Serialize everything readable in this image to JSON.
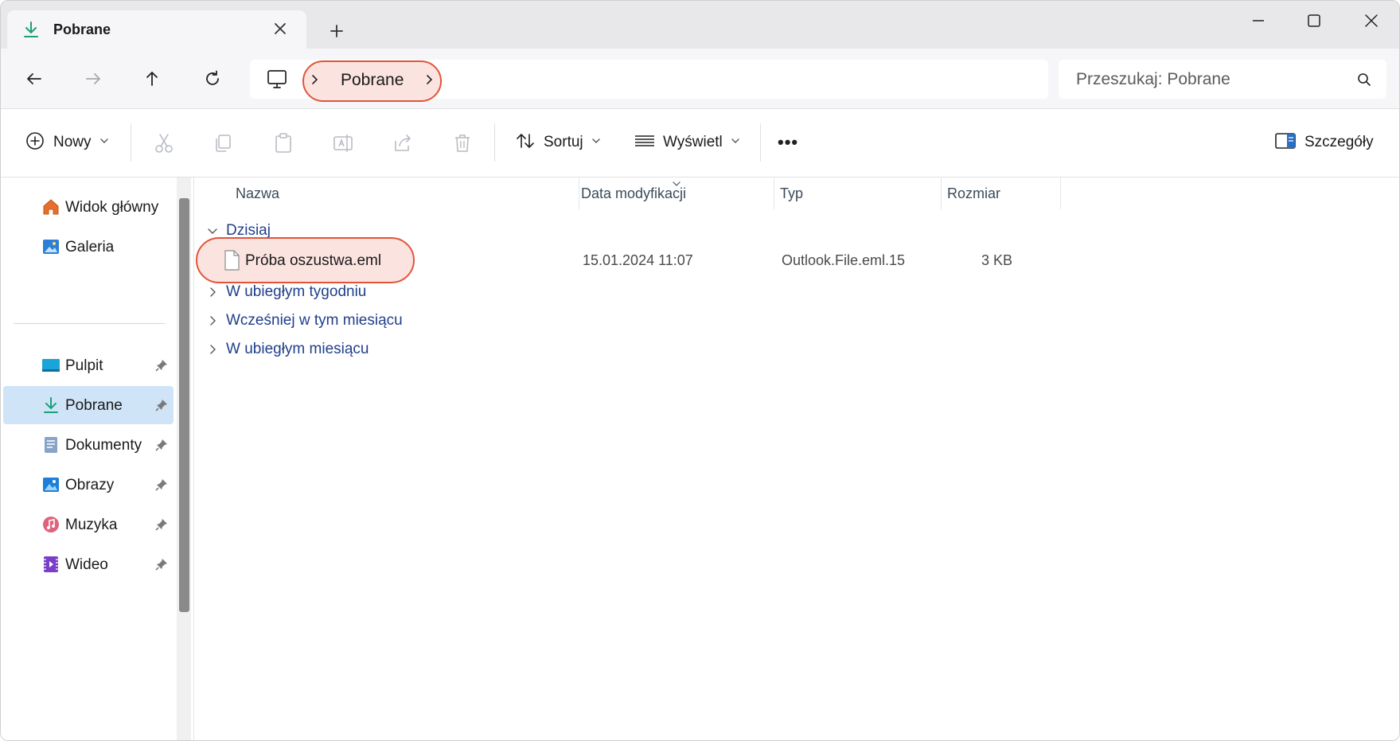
{
  "tab": {
    "title": "Pobrane",
    "icon": "download-icon"
  },
  "window_controls": [
    "minimize-icon",
    "maximize-icon",
    "close-icon"
  ],
  "address": {
    "location_icon": "computer-icon",
    "path": "Pobrane"
  },
  "search": {
    "placeholder": "Przeszukaj: Pobrane"
  },
  "toolbar": {
    "new_label": "Nowy",
    "sort_label": "Sortuj",
    "view_label": "Wyświetl",
    "more_label": "•••",
    "details_label": "Szczegóły"
  },
  "sidebar": {
    "top_items": [
      {
        "label": "Widok główny",
        "icon": "home-icon"
      },
      {
        "label": "Galeria",
        "icon": "gallery-icon"
      }
    ],
    "pinned_items": [
      {
        "label": "Pulpit",
        "icon": "desktop-icon"
      },
      {
        "label": "Pobrane",
        "icon": "download-icon",
        "active": true
      },
      {
        "label": "Dokumenty",
        "icon": "documents-icon"
      },
      {
        "label": "Obrazy",
        "icon": "pictures-icon"
      },
      {
        "label": "Muzyka",
        "icon": "music-icon"
      },
      {
        "label": "Wideo",
        "icon": "video-icon"
      }
    ]
  },
  "columns": {
    "name": "Nazwa",
    "date": "Data modyfikacji",
    "type": "Typ",
    "size": "Rozmiar"
  },
  "groups": {
    "today": "Dzisiaj",
    "last_week": "W ubiegłym tygodniu",
    "earlier_this_month": "Wcześniej w tym miesiącu",
    "last_month": "W ubiegłym miesiącu"
  },
  "files": [
    {
      "name": "Próba oszustwa.eml",
      "date": "15.01.2024 11:07",
      "type": "Outlook.File.eml.15",
      "size": "3 KB"
    }
  ],
  "colors": {
    "highlight_border": "#e2543a",
    "highlight_fill": "#fbe3e0",
    "group_text": "#1f3f8a",
    "active_item": "#cfe4f7"
  }
}
